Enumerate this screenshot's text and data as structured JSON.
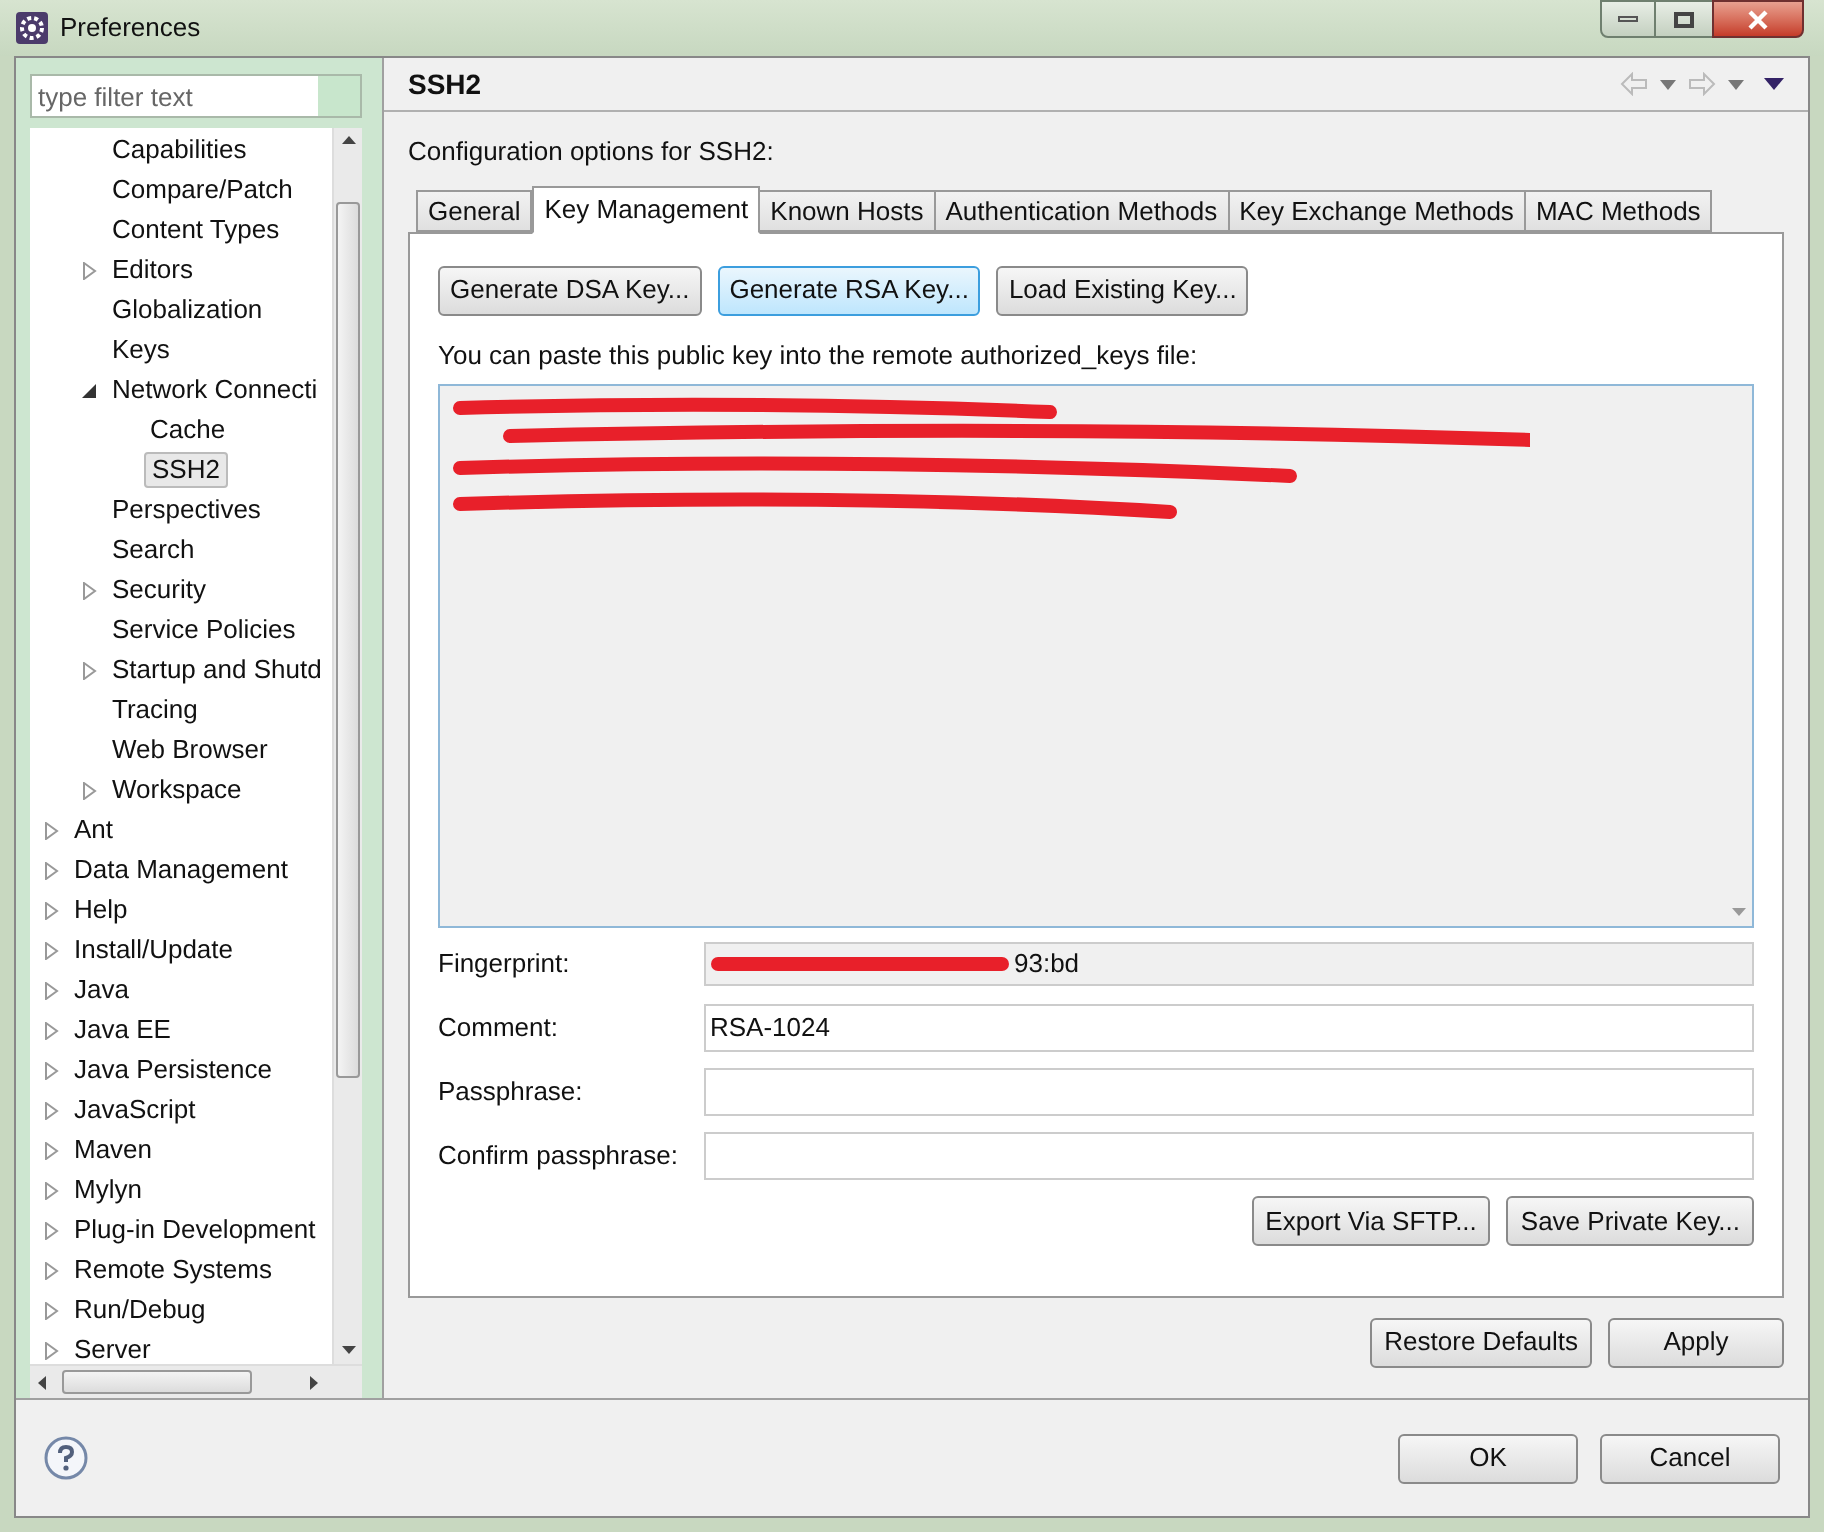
{
  "window": {
    "title": "Preferences"
  },
  "filter": {
    "placeholder": "type filter text"
  },
  "tree": {
    "nested_items": [
      {
        "label": "Capabilities",
        "kind": "leaf",
        "selected": false
      },
      {
        "label": "Compare/Patch",
        "kind": "leaf",
        "selected": false
      },
      {
        "label": "Content Types",
        "kind": "leaf",
        "selected": false
      },
      {
        "label": "Editors",
        "kind": "folder",
        "expanded": false,
        "selected": false
      },
      {
        "label": "Globalization",
        "kind": "leaf",
        "selected": false
      },
      {
        "label": "Keys",
        "kind": "leaf",
        "selected": false
      },
      {
        "label": "Network Connecti",
        "kind": "folder",
        "expanded": true,
        "selected": false,
        "children": [
          {
            "label": "Cache",
            "selected": false
          },
          {
            "label": "SSH2",
            "selected": true
          }
        ]
      },
      {
        "label": "Perspectives",
        "kind": "leaf",
        "selected": false
      },
      {
        "label": "Search",
        "kind": "leaf",
        "selected": false
      },
      {
        "label": "Security",
        "kind": "folder",
        "expanded": false,
        "selected": false
      },
      {
        "label": "Service Policies",
        "kind": "leaf",
        "selected": false
      },
      {
        "label": "Startup and Shutd",
        "kind": "folder",
        "expanded": false,
        "selected": false
      },
      {
        "label": "Tracing",
        "kind": "leaf",
        "selected": false
      },
      {
        "label": "Web Browser",
        "kind": "leaf",
        "selected": false
      },
      {
        "label": "Workspace",
        "kind": "folder",
        "expanded": false,
        "selected": false
      }
    ],
    "items": [
      {
        "label": "Ant",
        "kind": "folder",
        "expanded": false,
        "selected": false
      },
      {
        "label": "Data Management",
        "kind": "folder",
        "expanded": false,
        "selected": false
      },
      {
        "label": "Help",
        "kind": "folder",
        "expanded": false,
        "selected": false
      },
      {
        "label": "Install/Update",
        "kind": "folder",
        "expanded": false,
        "selected": false
      },
      {
        "label": "Java",
        "kind": "folder",
        "expanded": false,
        "selected": false
      },
      {
        "label": "Java EE",
        "kind": "folder",
        "expanded": false,
        "selected": false
      },
      {
        "label": "Java Persistence",
        "kind": "folder",
        "expanded": false,
        "selected": false
      },
      {
        "label": "JavaScript",
        "kind": "folder",
        "expanded": false,
        "selected": false
      },
      {
        "label": "Maven",
        "kind": "folder",
        "expanded": false,
        "selected": false
      },
      {
        "label": "Mylyn",
        "kind": "folder",
        "expanded": false,
        "selected": false
      },
      {
        "label": "Plug-in Development",
        "kind": "folder",
        "expanded": false,
        "selected": false
      },
      {
        "label": "Remote Systems",
        "kind": "folder",
        "expanded": false,
        "selected": false
      },
      {
        "label": "Run/Debug",
        "kind": "folder",
        "expanded": false,
        "selected": false
      },
      {
        "label": "Server",
        "kind": "folder",
        "expanded": false,
        "selected": false
      }
    ]
  },
  "page": {
    "title": "SSH2",
    "description": "Configuration options for SSH2:"
  },
  "tabs": [
    {
      "label": "General",
      "selected": false
    },
    {
      "label": "Key Management",
      "selected": true
    },
    {
      "label": "Known Hosts",
      "selected": false
    },
    {
      "label": "Authentication Methods",
      "selected": false
    },
    {
      "label": "Key Exchange Methods",
      "selected": false
    },
    {
      "label": "MAC Methods",
      "selected": false
    }
  ],
  "key_buttons": [
    {
      "label": "Generate DSA Key...",
      "focused": false
    },
    {
      "label": "Generate RSA Key...",
      "focused": true
    },
    {
      "label": "Load Existing Key...",
      "focused": false
    }
  ],
  "paste_hint": "You can paste this public key into the remote authorized_keys file:",
  "fields": [
    {
      "label": "Fingerprint:",
      "value": "93:bd",
      "kind": "readonly"
    },
    {
      "label": "Comment:",
      "value": "RSA-1024",
      "kind": "text"
    },
    {
      "label": "Passphrase:",
      "kind": "text"
    },
    {
      "label": "Confirm passphrase:",
      "kind": "text"
    }
  ],
  "export_buttons": [
    "Export Via SFTP...",
    "Save Private Key..."
  ],
  "page_buttons": [
    "Restore Defaults",
    "Apply"
  ],
  "dialog_buttons": [
    "OK",
    "Cancel"
  ]
}
